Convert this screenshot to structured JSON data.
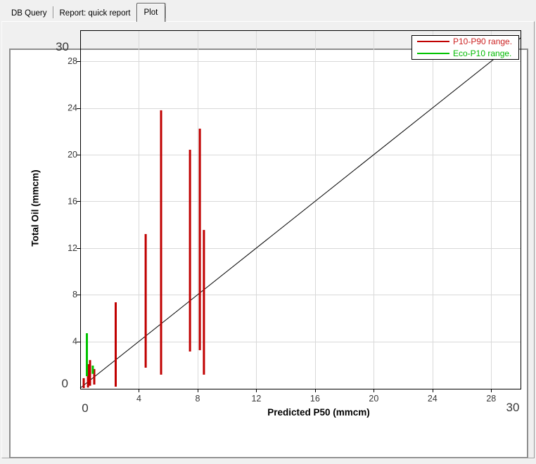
{
  "window": {
    "background": "#f0f0f0"
  },
  "tabs": {
    "items": [
      {
        "label": "DB Query",
        "selected": false
      },
      {
        "label": "Report: quick report",
        "selected": false
      },
      {
        "label": "Plot",
        "selected": true
      }
    ]
  },
  "legend": {
    "items": [
      {
        "label": "P10-P90 range.",
        "line_color": "#c00000",
        "text_color": "#cc2222"
      },
      {
        "label": "Eco-P10 range.",
        "line_color": "#00c300",
        "text_color": "#00bb00"
      }
    ],
    "position": "top-right"
  },
  "chart_data": {
    "type": "bar",
    "subtype": "floating-range-bars-with-identity-line",
    "title": "",
    "xlabel": "Predicted P50 (mmcm)",
    "ylabel": "Total Oil (mmcm)",
    "xlim": [
      0,
      30
    ],
    "ylim": [
      0,
      30
    ],
    "x_ticks": [
      4,
      8,
      12,
      16,
      20,
      24,
      28
    ],
    "y_ticks": [
      4,
      8,
      12,
      16,
      20,
      24,
      28
    ],
    "x_end_labels": [
      "0",
      "30"
    ],
    "y_end_labels": [
      "0",
      "30"
    ],
    "grid": true,
    "grid_color": "#d9d9d9",
    "axis_color": "#000000",
    "tick_label_color": "#373737",
    "series": [
      {
        "name": "P10-P90 range.",
        "kind": "range-bar",
        "color": "#c00000",
        "points": [
          {
            "x": 0.24,
            "low": 0.0,
            "high": 0.85
          },
          {
            "x": 0.53,
            "low": 0.05,
            "high": 2.05
          },
          {
            "x": 0.67,
            "low": 0.2,
            "high": 2.4
          },
          {
            "x": 0.96,
            "low": 0.3,
            "high": 1.63
          },
          {
            "x": 2.42,
            "low": 0.12,
            "high": 7.35
          },
          {
            "x": 4.46,
            "low": 1.75,
            "high": 13.2
          },
          {
            "x": 5.51,
            "low": 1.15,
            "high": 23.8
          },
          {
            "x": 7.48,
            "low": 3.13,
            "high": 20.42
          },
          {
            "x": 8.15,
            "low": 3.25,
            "high": 22.23
          },
          {
            "x": 8.43,
            "low": 1.15,
            "high": 13.55
          }
        ]
      },
      {
        "name": "Eco-P10 range.",
        "kind": "range-bar",
        "color": "#00c300",
        "points": [
          {
            "x": 0.455,
            "low": 1.02,
            "high": 4.7
          },
          {
            "x": 0.86,
            "low": 1.22,
            "high": 1.93
          }
        ]
      },
      {
        "name": "identity-line",
        "kind": "line",
        "color": "#000000",
        "points": [
          {
            "x": 0,
            "y": 0
          },
          {
            "x": 30,
            "y": 30
          }
        ]
      }
    ]
  }
}
